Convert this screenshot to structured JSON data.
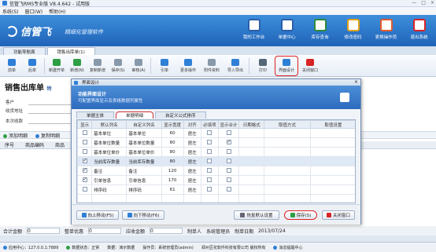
{
  "window": {
    "title": "信管飞RMS专业版 V8.4.642 - 试用版",
    "controls": [
      "—",
      "□",
      "×"
    ]
  },
  "menu": [
    "系统(S)",
    "窗口(W)",
    "帮助(H)"
  ],
  "banner": {
    "logo": "信管飞",
    "tagline": "精细化管理软件"
  },
  "topnav": [
    {
      "label": "我的工作台",
      "icon": "workbench-icon",
      "color": "#2a5fa8"
    },
    {
      "label": "单据中心",
      "icon": "documents-icon",
      "color": "#2a5fa8"
    },
    {
      "label": "库存查询",
      "icon": "inventory-icon",
      "color": "#2e8b3a"
    },
    {
      "label": "修改密码",
      "icon": "lock-icon",
      "color": "#e0a21a"
    },
    {
      "label": "更换操作员",
      "icon": "user-icon",
      "color": "#e25b2b"
    },
    {
      "label": "退出系统",
      "icon": "power-icon",
      "color": "#d82424"
    }
  ],
  "tabs": [
    "功能导航面",
    "销售出库单(1)"
  ],
  "toolbar": [
    {
      "label": "前单",
      "icon": "prev-icon",
      "color": "#2f7fd6"
    },
    {
      "label": "后单",
      "icon": "next-icon",
      "color": "#2f7fd6"
    },
    {
      "label": "新建开单",
      "icon": "new-icon",
      "color": "#2f9e44"
    },
    {
      "label": "新增(N)",
      "icon": "add-icon",
      "color": "#2f9e44"
    },
    {
      "label": "复制新增",
      "icon": "copy-icon",
      "color": "#8899aa"
    },
    {
      "label": "保存(S)",
      "icon": "save-icon",
      "color": "#8899aa"
    },
    {
      "label": "审核(A)",
      "icon": "approve-icon",
      "color": "#8899aa"
    },
    {
      "label": "引单",
      "icon": "import-icon",
      "color": "#2f7fd6"
    },
    {
      "label": "更多操作",
      "icon": "more-icon",
      "color": "#2f7fd6"
    },
    {
      "label": "附件资料",
      "icon": "attachment-icon",
      "color": "#8899aa"
    },
    {
      "label": "导入导出",
      "icon": "import-export-icon",
      "color": "#2f7fd6"
    },
    {
      "label": "打印",
      "icon": "print-icon",
      "color": "#556677"
    },
    {
      "label": "界面设计",
      "icon": "design-icon",
      "color": "#2f7fd6"
    },
    {
      "label": "关闭窗口",
      "icon": "close-window-icon",
      "color": "#d82424"
    }
  ],
  "form": {
    "title": "销售出库单",
    "title_suffix": "特",
    "labels": [
      "客户",
      "收货地址",
      "本次收款"
    ]
  },
  "grid": {
    "tools": [
      "添加明细",
      "复制明细"
    ],
    "headers": [
      "序号",
      "商品编码",
      "商品"
    ]
  },
  "totals": {
    "label": "合计金额",
    "value": "0",
    "extra": [
      "整单优惠",
      "0",
      "应收金额",
      "0",
      "制单人",
      "系统管理员",
      "制单日期",
      "2013/07/24"
    ]
  },
  "status": [
    "应用中心：127.0.0.1:7889",
    "数据状态：正常",
    "数据：演示数据",
    "操作员：系统管理员(admin)",
    "郑州豆花软件科技有限公司 版权所有",
    "消息提醒中心"
  ],
  "dialog": {
    "title": "界面设计",
    "header_title": "功能界面设计",
    "header_sub": "可配置界面显示及表格数据列属性",
    "tabs": [
      "单据主体",
      "单据明细",
      "自定义公式排序"
    ],
    "active_tab": 1,
    "columns": [
      "显示",
      "默认列名",
      "自定义列名",
      "显示宽度",
      "对齐",
      "必填项",
      "显示合计",
      "日期格式",
      "取值方式",
      "取值设置"
    ],
    "rows": [
      {
        "show": false,
        "default": "基本单位",
        "custom": "基本单位",
        "width": "60",
        "align": "居左",
        "required": false,
        "total": false
      },
      {
        "show": false,
        "default": "基本单位数量",
        "custom": "基本单位数量",
        "width": "80",
        "align": "居左",
        "required": false,
        "total": true
      },
      {
        "show": false,
        "default": "基本单位单价",
        "custom": "基本单位单价",
        "width": "80",
        "align": "居左",
        "required": false,
        "total": false
      },
      {
        "show": true,
        "default": "当前库存数量",
        "custom": "当前库存数量",
        "width": "80",
        "align": "居左",
        "required": false,
        "total": false
      },
      {
        "show": true,
        "default": "备注",
        "custom": "备注",
        "width": "120",
        "align": "居左",
        "required": false,
        "total": false
      },
      {
        "show": true,
        "default": "引单信息",
        "custom": "引单信息",
        "width": "170",
        "align": "居左",
        "required": false,
        "total": false
      },
      {
        "show": false,
        "default": "排序码",
        "custom": "排序码",
        "width": "61",
        "align": "居左",
        "required": false,
        "total": false
      }
    ],
    "buttons": {
      "up": "向上移动(F5)",
      "down": "向下移动(F6)",
      "reset": "恢复默认设置",
      "save": "保存(S)",
      "close": "关闭窗口"
    }
  }
}
